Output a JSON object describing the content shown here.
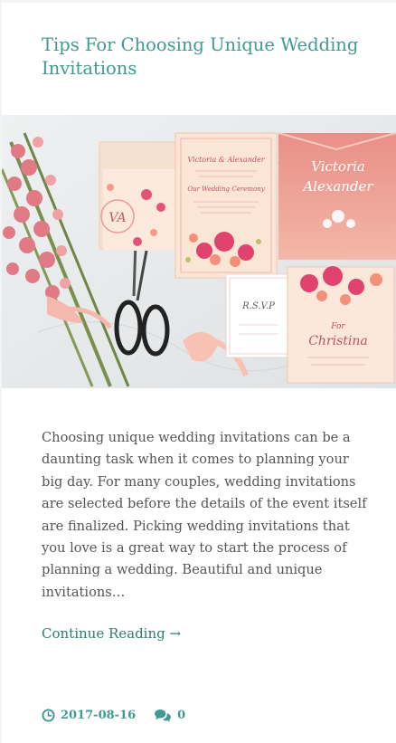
{
  "post": {
    "title": "Tips For Choosing Unique Wedding Invitations",
    "image_alt": "Wedding invitation suite with pink floral designs",
    "image_text": {
      "card_names": "Victoria & Alexander",
      "card_event": "Our Wedding Ceremony",
      "pocket_names_1": "Victoria",
      "pocket_names_2": "Alexander",
      "rsvp": "R.S.V.P",
      "monogram": "VA",
      "for": "For",
      "guest": "Christina"
    },
    "excerpt": "Choosing unique wedding invitations can be a daunting task when it comes to planning your big day. For many couples, wedding invitations are selected before the details of the event itself are finalized. Picking wedding invitations that you love is a great way to start the process of planning a wedding. Beautiful and unique invitations…",
    "continue_label": "Continue Reading →",
    "date": "2017-08-16",
    "comments": "0"
  },
  "colors": {
    "accent": "#3f9a93",
    "link": "#2f7c76",
    "text": "#555555"
  },
  "icons": {
    "date": "clock-icon",
    "comments": "comments-icon"
  }
}
